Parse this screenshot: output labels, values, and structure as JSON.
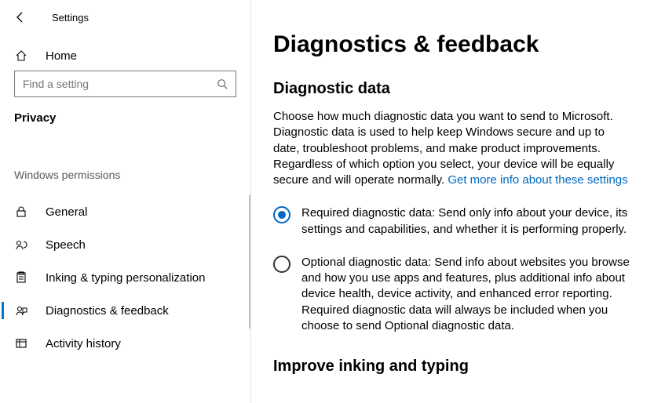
{
  "header": {
    "title": "Settings"
  },
  "nav": {
    "home_label": "Home"
  },
  "search": {
    "placeholder": "Find a setting"
  },
  "section": {
    "label": "Privacy"
  },
  "subgroup": {
    "label": "Windows permissions"
  },
  "perm_items": {
    "general": "General",
    "speech": "Speech",
    "inking": "Inking & typing personalization",
    "diag": "Diagnostics & feedback",
    "activity": "Activity history"
  },
  "main": {
    "title": "Diagnostics & feedback",
    "section1_title": "Diagnostic data",
    "section1_body": "Choose how much diagnostic data you want to send to Microsoft. Diagnostic data is used to help keep Windows secure and up to date, troubleshoot problems, and make product improvements. Regardless of which option you select, your device will be equally secure and will operate normally. ",
    "section1_link": "Get more info about these settings",
    "radio_required_title": "Required diagnostic data:",
    "radio_required_body": " Send only info about your device, its settings and capabilities, and whether it is performing properly.",
    "radio_optional_title": "Optional diagnostic data:",
    "radio_optional_body": " Send info about websites you browse and how you use apps and features, plus additional info about device health, device activity, and enhanced error reporting. Required diagnostic data will always be included when you choose to send Optional diagnostic data.",
    "section2_title": "Improve inking and typing"
  }
}
